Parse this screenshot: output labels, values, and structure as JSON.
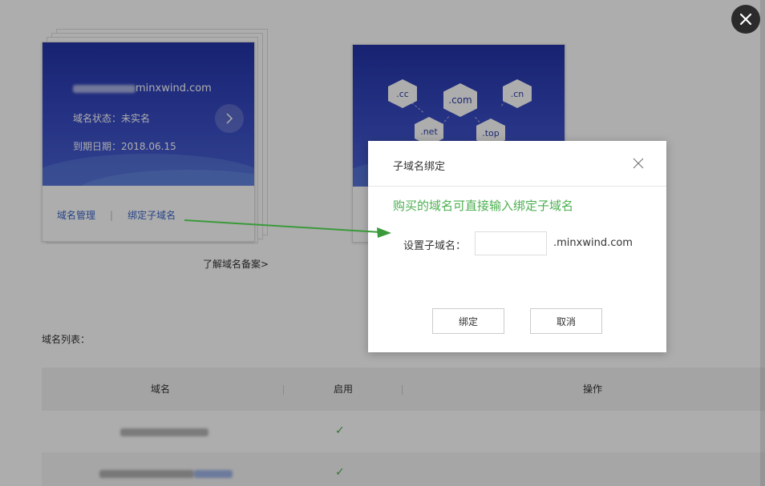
{
  "domain_card": {
    "domain_suffix": "minxwind.com",
    "status": "域名状态：未实名",
    "expiry": "到期日期：2018.06.15",
    "manage_label": "域名管理",
    "bind_label": "绑定子域名"
  },
  "promo_card": {
    "tlds": [
      ".cc",
      ".com",
      ".cn",
      ".net",
      ".top"
    ]
  },
  "learn_link": "了解域名备案>",
  "domain_list": {
    "label": "域名列表：",
    "columns": [
      "域名",
      "启用",
      "操作"
    ],
    "rows": [
      {
        "enabled_mark": "✓"
      },
      {
        "enabled_mark": "✓"
      }
    ]
  },
  "dialog": {
    "title": "子域名绑定",
    "notice": "购买的域名可直接输入绑定子域名",
    "field_label": "设置子域名：",
    "field_value": "",
    "suffix": ".minxwind.com",
    "confirm_label": "绑定",
    "cancel_label": "取消"
  },
  "colors": {
    "accent_green": "#4caf50",
    "link_blue": "#3a65c6",
    "banner_blue": "#2e3fb4"
  },
  "icons": [
    "close-icon",
    "chevron-right-icon",
    "dialog-close-icon",
    "check-icon",
    "annotation-arrow"
  ]
}
